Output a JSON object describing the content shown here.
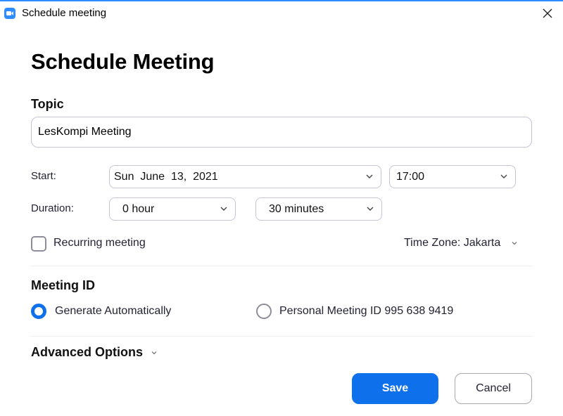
{
  "window": {
    "title": "Schedule meeting",
    "accent_color": "#0e71eb",
    "icons": {
      "app": "zoom-camera-icon",
      "close": "close-icon"
    }
  },
  "page_title": "Schedule Meeting",
  "topic": {
    "label": "Topic",
    "value": "LesKompi Meeting"
  },
  "start": {
    "label": "Start:",
    "date": "Sun  June  13,  2021",
    "time": "17:00"
  },
  "duration": {
    "label": "Duration:",
    "hours": "0 hour",
    "minutes": "30 minutes"
  },
  "recurring": {
    "label": "Recurring meeting",
    "checked": false
  },
  "time_zone": {
    "label": "Time Zone: Jakarta"
  },
  "meeting_id": {
    "label": "Meeting ID",
    "options": [
      {
        "label": "Generate Automatically",
        "selected": true
      },
      {
        "label": "Personal Meeting ID 995 638 9419",
        "selected": false
      }
    ]
  },
  "advanced_options": {
    "label": "Advanced Options"
  },
  "buttons": {
    "save": "Save",
    "cancel": "Cancel"
  }
}
